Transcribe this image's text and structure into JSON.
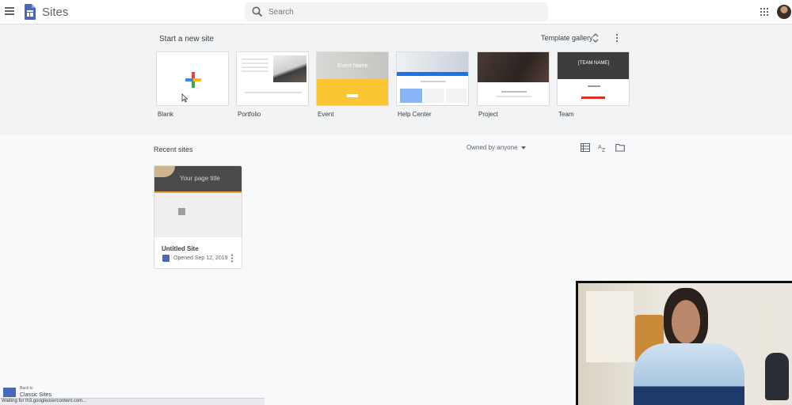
{
  "header": {
    "app_title": "Sites",
    "search_placeholder": "Search"
  },
  "templates": {
    "section_title": "Start a new site",
    "gallery_label": "Template gallery",
    "items": [
      {
        "label": "Blank"
      },
      {
        "label": "Portfolio"
      },
      {
        "label": "Event",
        "thumb_text": "Event Name"
      },
      {
        "label": "Help Center"
      },
      {
        "label": "Project"
      },
      {
        "label": "Team",
        "thumb_text": "[TEAM NAME]"
      }
    ]
  },
  "recent": {
    "title": "Recent sites",
    "owner_filter": "Owned by anyone",
    "sites": [
      {
        "name": "Untitled Site",
        "opened": "Opened Sep 12, 2019",
        "thumb_title": "Your page title"
      }
    ]
  },
  "classic": {
    "back_text": "Back to",
    "label": "Classic Sites"
  },
  "status_bar": "Waiting for lh3.googleusercontent.com...",
  "colors": {
    "accent_blue": "#4a67b8",
    "event_yellow": "#fbc634",
    "helpcenter_blue": "#1a73e8",
    "team_red": "#d93025"
  }
}
